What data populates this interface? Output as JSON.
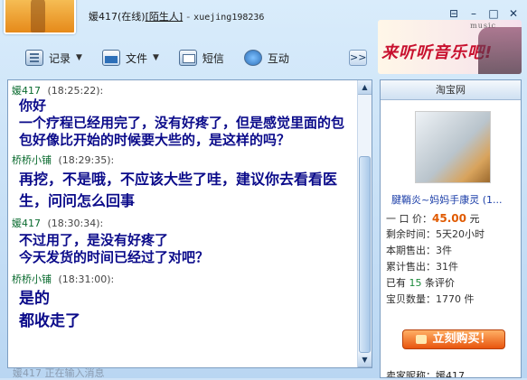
{
  "title": {
    "name": "媛417",
    "status": "(在线)",
    "relation": "[陌生人]",
    "separator": "-",
    "account": "xuejing198236"
  },
  "toolbar": {
    "records_label": "记录",
    "file_label": "文件",
    "sms_label": "短信",
    "interact_label": "互动",
    "more_label": ">>"
  },
  "banner": {
    "music_word": "music",
    "slogan": "来听听音乐吧!"
  },
  "chat": {
    "messages": [
      {
        "sender": "媛417",
        "time": "(18:25:22):",
        "lines": [
          "你好",
          "一个疗程已经用完了，没有好疼了，但是感觉里面的包包好像比开始的时候要大些的，是这样的吗？"
        ]
      },
      {
        "sender": "桥桥小铺",
        "time": "(18:29:35):",
        "lines": [
          "再挖，不是哦，不应该大些了哇，建议你去看看医生，问问怎么回事"
        ]
      },
      {
        "sender": "媛417",
        "time": "(18:30:34):",
        "lines": [
          "不过用了，是没有好疼了",
          "今天发货的时间已经过了对吧？"
        ]
      },
      {
        "sender": "桥桥小铺",
        "time": "(18:31:00):",
        "lines": [
          "是的",
          "都收走了"
        ]
      }
    ],
    "typing_status": "媛417 正在输入消息"
  },
  "shop": {
    "header": "淘宝网",
    "product_name": "腱鞘炎~妈妈手康灵 (1...",
    "price_label": "一 口 价：",
    "price_value": "45.00",
    "price_unit": "元",
    "time_left_label": "剩余时间：",
    "time_left_value": "5天20小时",
    "sold_period_label": "本期售出：",
    "sold_period_value": "3件",
    "sold_total_label": "累计售出：",
    "sold_total_value": "31件",
    "reviews_prefix": "已有",
    "reviews_count": "15",
    "reviews_suffix": "条评价",
    "stock_label": "宝贝数量：",
    "stock_value": "1770 件",
    "buy_label": "立刻购买！",
    "seller_label": "卖家昵称：",
    "seller_value": "媛417"
  }
}
